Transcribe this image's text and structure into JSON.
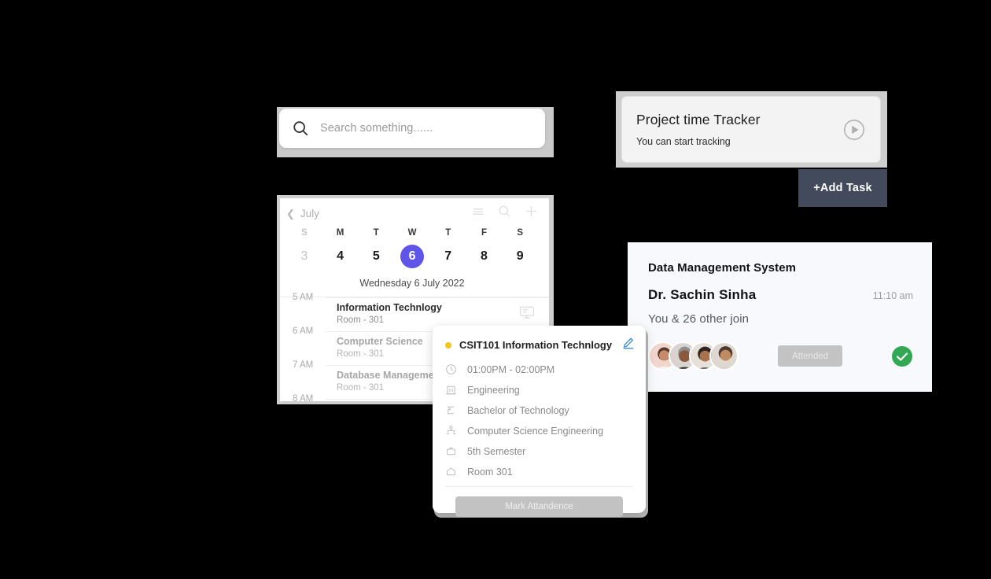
{
  "search": {
    "placeholder": "Search something......",
    "value": "",
    "icon": "search-icon"
  },
  "tracker": {
    "title": "Project time Tracker",
    "subtitle": "You can start tracking",
    "play_icon": "play-circle-icon",
    "add_task_label": "+Add Task",
    "add_task_color": "#434a5c"
  },
  "calendar": {
    "back_icon": "chevron-left-icon",
    "month": "July",
    "icons": [
      "list-icon",
      "search-icon",
      "plus-icon"
    ],
    "dows": [
      "S",
      "M",
      "T",
      "W",
      "T",
      "F",
      "S"
    ],
    "dates": [
      "3",
      "4",
      "5",
      "6",
      "7",
      "8",
      "9"
    ],
    "selected_index": 3,
    "selected_color": "#5f55e8",
    "full_date": "Wednesday 6 July 2022",
    "schedule": [
      {
        "time": "5 AM",
        "name": "Information Technlogy",
        "room": "Room - 301",
        "active": true,
        "icon": "monitor-icon"
      },
      {
        "time": "6 AM",
        "name": "Computer Science",
        "room": "Room - 301",
        "active": false,
        "icon": ""
      },
      {
        "time": "7 AM",
        "name": "Database Management",
        "room": "Room - 301",
        "active": false,
        "icon": ""
      },
      {
        "time": "8 AM",
        "name": "",
        "room": "",
        "active": false,
        "icon": ""
      }
    ]
  },
  "popup": {
    "dot_color": "#f2c41a",
    "title": "CSIT101 Information Technlogy",
    "edit_icon": "pencil-icon",
    "rows": [
      {
        "icon": "clock-icon",
        "text": "01:00PM - 02:00PM"
      },
      {
        "icon": "building-icon",
        "text": "Engineering"
      },
      {
        "icon": "graduation-cap-icon",
        "text": "Bachelor of Technology"
      },
      {
        "icon": "people-hierarchy-icon",
        "text": "Computer Science Engineering"
      },
      {
        "icon": "briefcase-icon",
        "text": "5th Semester"
      },
      {
        "icon": "home-icon",
        "text": "Room 301"
      }
    ],
    "button_label": "Mark Attandence"
  },
  "meeting": {
    "title": "Data Management System",
    "host": "Dr. Sachin Sinha",
    "time": "11:10 am",
    "participants": "You & 26 other join",
    "attendee_count": 4,
    "attended_label": "Attended",
    "status_icon": "check-circle-icon",
    "status_color": "#32a852"
  }
}
